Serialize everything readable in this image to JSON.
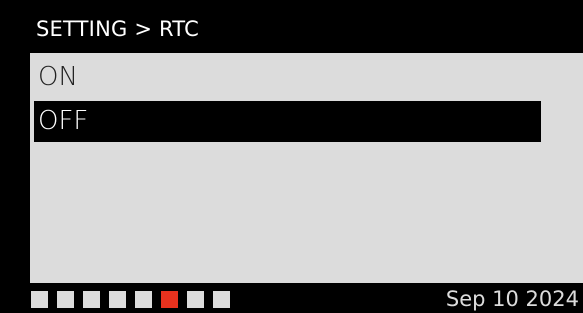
{
  "header": {
    "breadcrumb": "SETTING > RTC"
  },
  "menu": {
    "items": [
      {
        "label": "ON",
        "selected": false
      },
      {
        "label": "OFF",
        "selected": true
      }
    ]
  },
  "footer": {
    "page_indicators": [
      {
        "active": false
      },
      {
        "active": false
      },
      {
        "active": false
      },
      {
        "active": false
      },
      {
        "active": false
      },
      {
        "active": true
      },
      {
        "active": false
      },
      {
        "active": false
      }
    ],
    "date": "Sep 10 2024"
  },
  "colors": {
    "background": "#000000",
    "menu_background": "#dcdcdc",
    "selection_background": "#000000",
    "selection_text": "#ffffff",
    "indicator_inactive": "#dcdcdc",
    "indicator_active": "#e8321e"
  }
}
